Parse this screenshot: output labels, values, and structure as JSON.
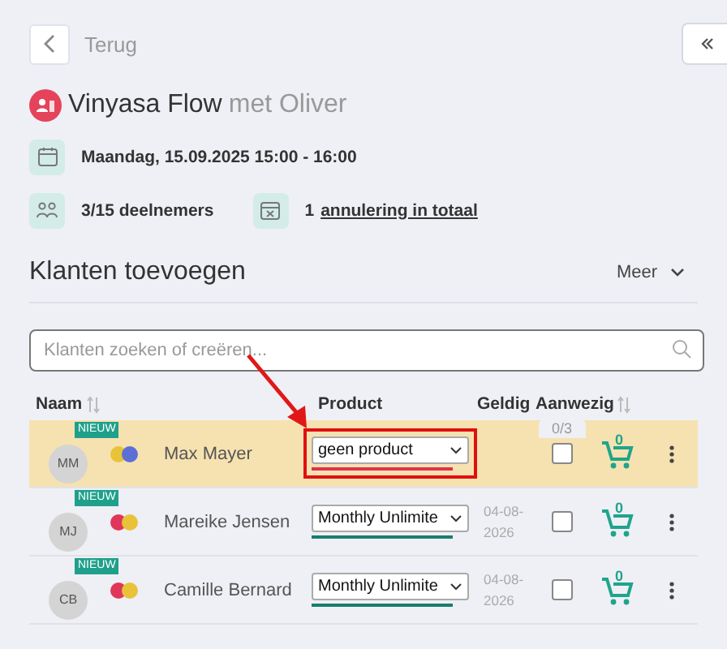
{
  "back": {
    "label": "Terug"
  },
  "title": {
    "name": "Vinyasa Flow",
    "teacher": "met Oliver"
  },
  "details": {
    "date": "Maandag, 15.09.2025 15:00 - 16:00",
    "participants": "3/15 deelnemers",
    "cancel_count": "1",
    "cancel_link": "annulering in totaal"
  },
  "section": {
    "title": "Klanten toevoegen",
    "more": "Meer"
  },
  "search": {
    "placeholder": "Klanten zoeken of creëren..."
  },
  "table": {
    "columns": [
      "Naam",
      "Product",
      "Geldig",
      "Aanwezig"
    ],
    "attendance": "0/3",
    "rows": [
      {
        "initials": "MM",
        "badge": "NIEUW",
        "dots": [
          {
            "color": "#e8c33a"
          },
          {
            "color": "#5b6fd6"
          }
        ],
        "name": "Max Mayer",
        "product": "geen product",
        "product_valid": false,
        "valid_until": "",
        "checked": false,
        "cart": "0",
        "selected": true,
        "highlighted": true
      },
      {
        "initials": "MJ",
        "badge": "NIEUW",
        "dots": [
          {
            "color": "#e0365a"
          },
          {
            "color": "#e8c33a"
          }
        ],
        "name": "Mareike Jensen",
        "product": "Monthly Unlimite",
        "product_valid": true,
        "valid_until": "04-08-2026",
        "checked": false,
        "cart": "0",
        "selected": false,
        "highlighted": false
      },
      {
        "initials": "CB",
        "badge": "NIEUW",
        "dots": [
          {
            "color": "#e0365a"
          },
          {
            "color": "#e8c33a"
          }
        ],
        "name": "Camille Bernard",
        "product": "Monthly Unlimite",
        "product_valid": true,
        "valid_until": "04-08-2026",
        "checked": false,
        "cart": "0",
        "selected": false,
        "highlighted": false
      }
    ]
  }
}
